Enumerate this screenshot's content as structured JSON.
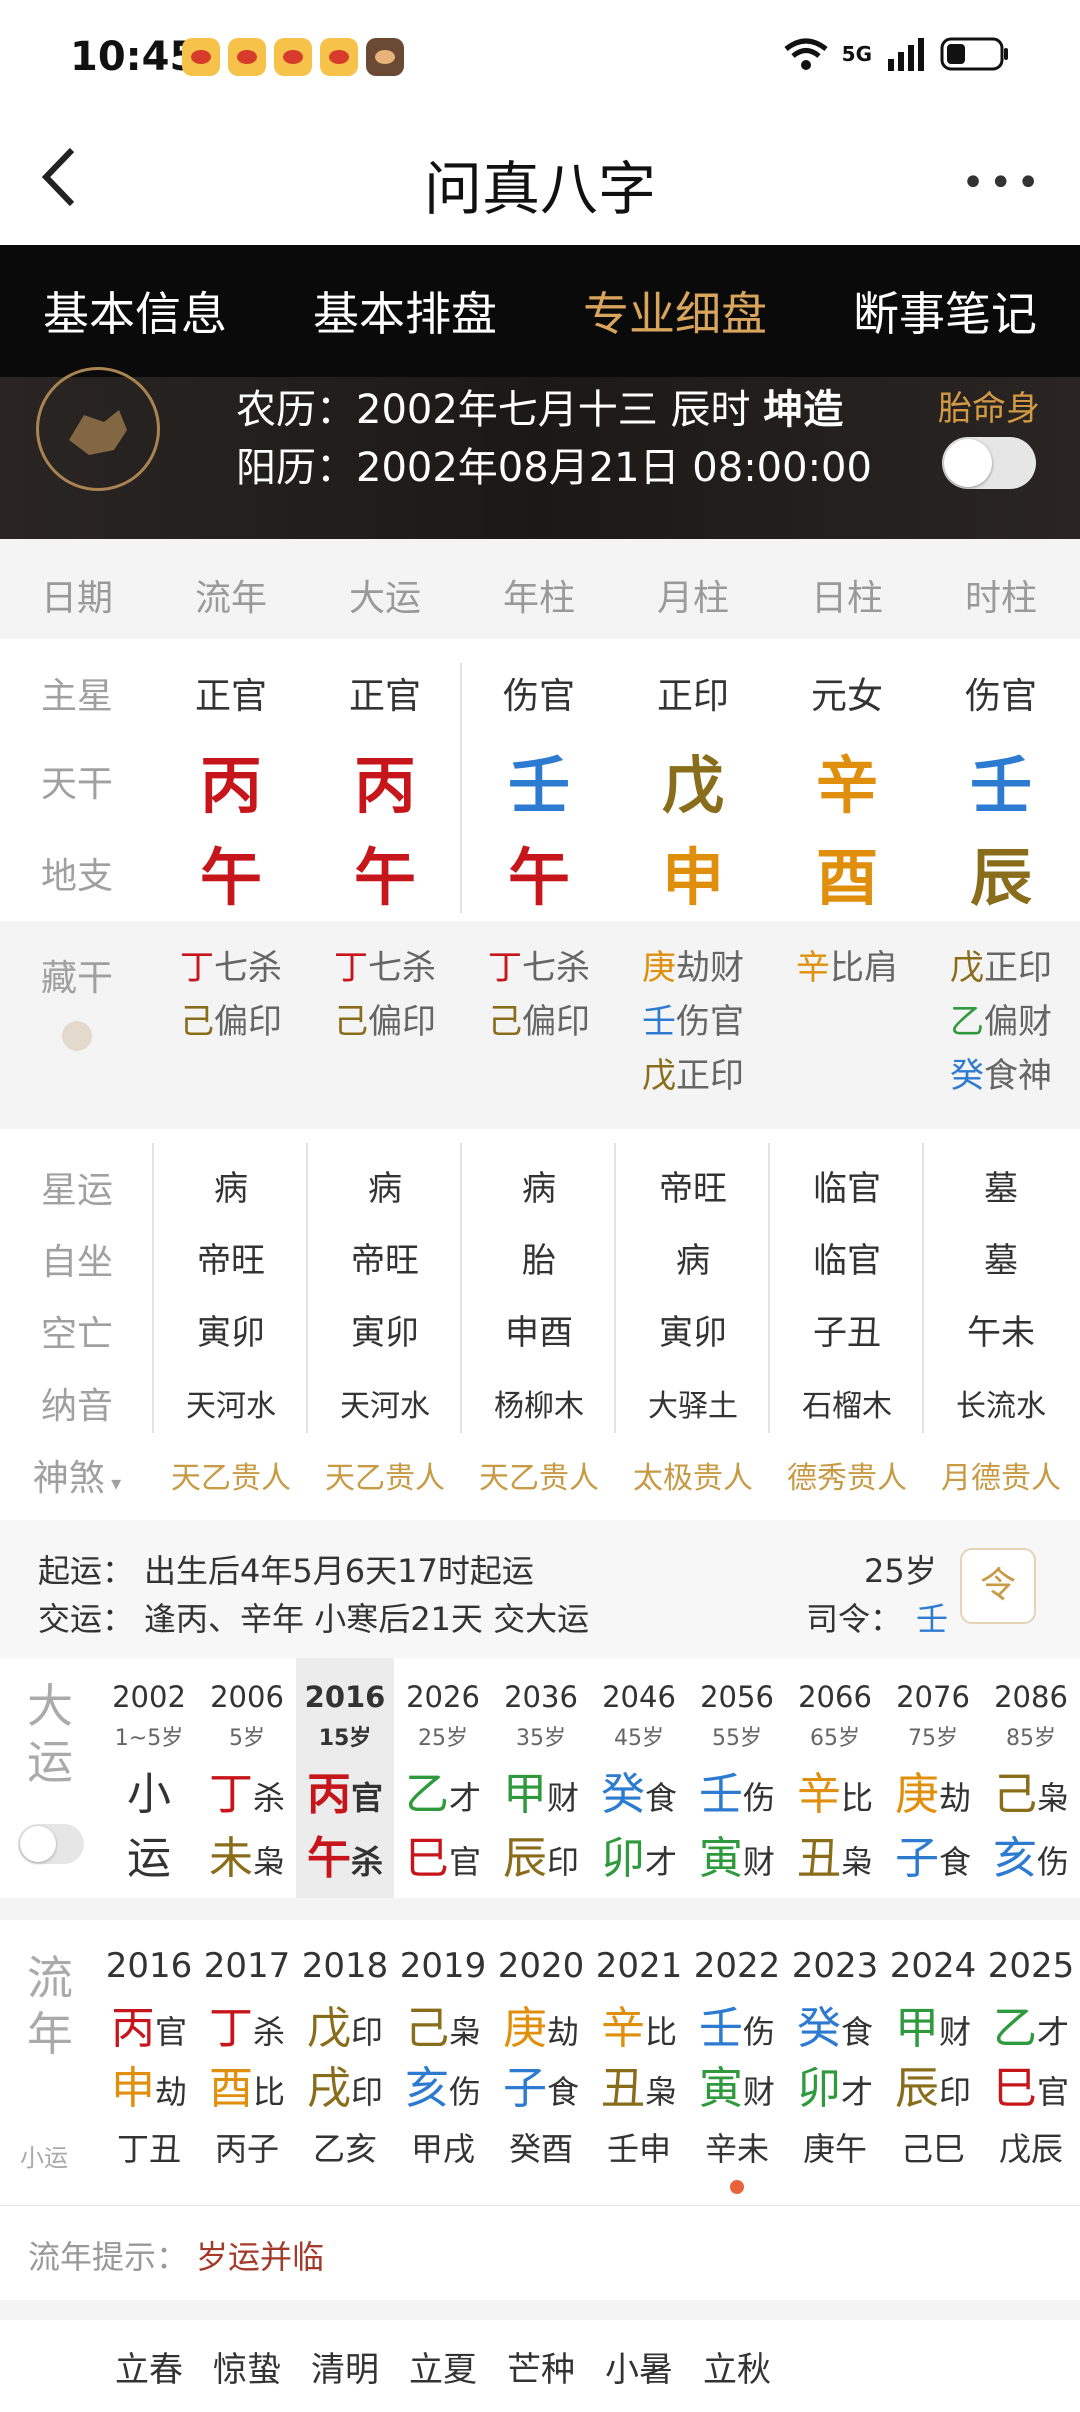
{
  "status": {
    "time": "10:45",
    "network": "5G"
  },
  "header": {
    "title": "问真八字"
  },
  "tabs": [
    "基本信息",
    "基本排盘",
    "专业细盘",
    "断事笔记"
  ],
  "banner": {
    "lunar_prefix": "农历：",
    "lunar_date": "2002年七月十三 辰时",
    "gender_label": "坤造",
    "solar_prefix": "阳历：",
    "solar_date": "2002年08月21日 08:00:00",
    "toggle_label": "胎命身"
  },
  "columns": [
    "日期",
    "流年",
    "大运",
    "年柱",
    "月柱",
    "日柱",
    "时柱"
  ],
  "rows": {
    "zhuxing_label": "主星",
    "zhuxing": [
      "正官",
      "正官",
      "伤官",
      "正印",
      "元女",
      "伤官"
    ],
    "tiangan_label": "天干",
    "tiangan": [
      "丙",
      "丙",
      "壬",
      "戊",
      "辛",
      "壬"
    ],
    "dizhi_label": "地支",
    "dizhi": [
      "午",
      "午",
      "午",
      "申",
      "酉",
      "辰"
    ],
    "canggan_label": "藏干",
    "canggan": [
      [
        [
          "丁",
          "七杀"
        ],
        [
          "己",
          "偏印"
        ]
      ],
      [
        [
          "丁",
          "七杀"
        ],
        [
          "己",
          "偏印"
        ]
      ],
      [
        [
          "丁",
          "七杀"
        ],
        [
          "己",
          "偏印"
        ]
      ],
      [
        [
          "庚",
          "劫财"
        ],
        [
          "壬",
          "伤官"
        ],
        [
          "戊",
          "正印"
        ]
      ],
      [
        [
          "辛",
          "比肩"
        ]
      ],
      [
        [
          "戊",
          "正印"
        ],
        [
          "乙",
          "偏财"
        ],
        [
          "癸",
          "食神"
        ]
      ]
    ],
    "xingyun_label": "星运",
    "xingyun": [
      "病",
      "病",
      "病",
      "帝旺",
      "临官",
      "墓"
    ],
    "zizuo_label": "自坐",
    "zizuo": [
      "帝旺",
      "帝旺",
      "胎",
      "病",
      "临官",
      "墓"
    ],
    "kongwang_label": "空亡",
    "kongwang": [
      "寅卯",
      "寅卯",
      "申酉",
      "寅卯",
      "子丑",
      "午未"
    ],
    "nayin_label": "纳音",
    "nayin": [
      "天河水",
      "天河水",
      "杨柳木",
      "大驿土",
      "石榴木",
      "长流水"
    ],
    "shensha_label": "神煞",
    "shensha": [
      "天乙贵人",
      "天乙贵人",
      "天乙贵人",
      "太极贵人",
      "德秀贵人",
      "月德贵人"
    ]
  },
  "qiyun": {
    "label1": "起运：",
    "text1": "出生后4年5月6天17时起运",
    "label2": "交运：",
    "text2": "逢丙、辛年 小寒后21天 交大运",
    "age": "25岁",
    "siling_label": "司令：",
    "siling_value": "壬"
  },
  "dayun": {
    "label": [
      "大",
      "运"
    ],
    "items": [
      {
        "year": "2002",
        "age": "1~5岁",
        "gan": "小",
        "gan_ss": "",
        "zhi": "运",
        "zhi_ss": ""
      },
      {
        "year": "2006",
        "age": "5岁",
        "gan": "丁",
        "gan_ss": "杀",
        "zhi": "未",
        "zhi_ss": "枭"
      },
      {
        "year": "2016",
        "age": "15岁",
        "gan": "丙",
        "gan_ss": "官",
        "zhi": "午",
        "zhi_ss": "杀"
      },
      {
        "year": "2026",
        "age": "25岁",
        "gan": "乙",
        "gan_ss": "才",
        "zhi": "巳",
        "zhi_ss": "官"
      },
      {
        "year": "2036",
        "age": "35岁",
        "gan": "甲",
        "gan_ss": "财",
        "zhi": "辰",
        "zhi_ss": "印"
      },
      {
        "year": "2046",
        "age": "45岁",
        "gan": "癸",
        "gan_ss": "食",
        "zhi": "卯",
        "zhi_ss": "才"
      },
      {
        "year": "2056",
        "age": "55岁",
        "gan": "壬",
        "gan_ss": "伤",
        "zhi": "寅",
        "zhi_ss": "财"
      },
      {
        "year": "2066",
        "age": "65岁",
        "gan": "辛",
        "gan_ss": "比",
        "zhi": "丑",
        "zhi_ss": "枭"
      },
      {
        "year": "2076",
        "age": "75岁",
        "gan": "庚",
        "gan_ss": "劫",
        "zhi": "子",
        "zhi_ss": "食"
      },
      {
        "year": "2086",
        "age": "85岁",
        "gan": "己",
        "gan_ss": "枭",
        "zhi": "亥",
        "zhi_ss": "伤"
      }
    ]
  },
  "liunian": {
    "label": [
      "流",
      "年"
    ],
    "sub_label": "小运",
    "items": [
      {
        "year": "2016",
        "gan": "丙",
        "gan_ss": "官",
        "zhi": "申",
        "zhi_ss": "劫",
        "xy": "丁丑"
      },
      {
        "year": "2017",
        "gan": "丁",
        "gan_ss": "杀",
        "zhi": "酉",
        "zhi_ss": "比",
        "xy": "丙子"
      },
      {
        "year": "2018",
        "gan": "戊",
        "gan_ss": "印",
        "zhi": "戌",
        "zhi_ss": "印",
        "xy": "乙亥"
      },
      {
        "year": "2019",
        "gan": "己",
        "gan_ss": "枭",
        "zhi": "亥",
        "zhi_ss": "伤",
        "xy": "甲戌"
      },
      {
        "year": "2020",
        "gan": "庚",
        "gan_ss": "劫",
        "zhi": "子",
        "zhi_ss": "食",
        "xy": "癸酉"
      },
      {
        "year": "2021",
        "gan": "辛",
        "gan_ss": "比",
        "zhi": "丑",
        "zhi_ss": "枭",
        "xy": "壬申"
      },
      {
        "year": "2022",
        "gan": "壬",
        "gan_ss": "伤",
        "zhi": "寅",
        "zhi_ss": "财",
        "xy": "辛未"
      },
      {
        "year": "2023",
        "gan": "癸",
        "gan_ss": "食",
        "zhi": "卯",
        "zhi_ss": "才",
        "xy": "庚午"
      },
      {
        "year": "2024",
        "gan": "甲",
        "gan_ss": "财",
        "zhi": "辰",
        "zhi_ss": "印",
        "xy": "己巳"
      },
      {
        "year": "2025",
        "gan": "乙",
        "gan_ss": "才",
        "zhi": "巳",
        "zhi_ss": "官",
        "xy": "戊辰"
      }
    ]
  },
  "tip": {
    "label": "流年提示：",
    "value": "岁运并临"
  },
  "jieqi": [
    "立春",
    "惊蛰",
    "清明",
    "立夏",
    "芒种",
    "小暑",
    "立秋"
  ],
  "colors": {
    "fire": "#c7161b",
    "water": "#2c7bd1",
    "earth": "#8a6d1b",
    "metal": "#e08f0c",
    "wood": "#2f9a3d",
    "accent": "#d9a45b"
  }
}
